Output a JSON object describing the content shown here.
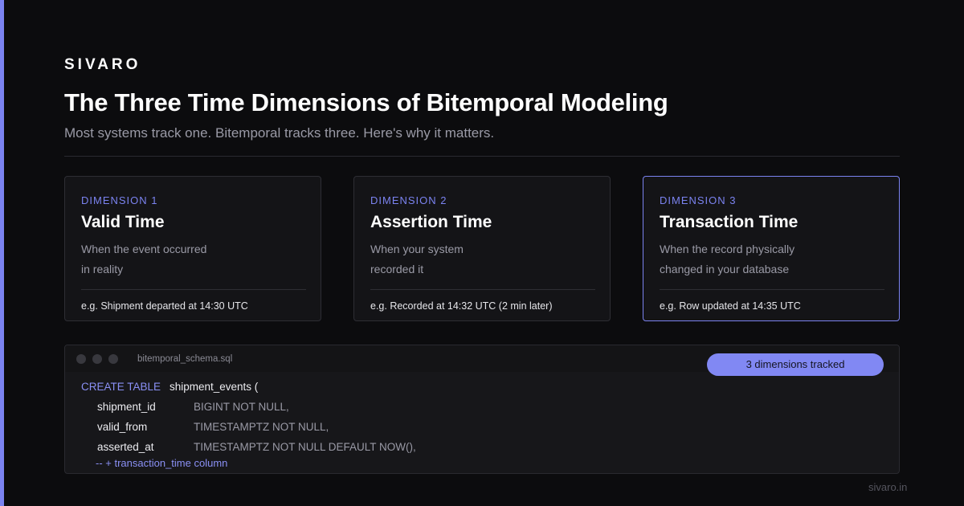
{
  "brand": "SIVARO",
  "title": "The Three Time Dimensions of Bitemporal Modeling",
  "subtitle": "Most systems track one. Bitemporal tracks three. Here's why it matters.",
  "accent_color": "#7b83f0",
  "cards": [
    {
      "kicker": "DIMENSION 1",
      "title": "Valid Time",
      "desc_lines": [
        "When the event occurred",
        "in reality"
      ],
      "example": "e.g. Shipment departed at 14:30 UTC"
    },
    {
      "kicker": "DIMENSION 2",
      "title": "Assertion Time",
      "desc_lines": [
        "When your system",
        "recorded it"
      ],
      "example": "e.g. Recorded at 14:32 UTC (2 min later)"
    },
    {
      "kicker": "DIMENSION 3",
      "title": "Transaction Time",
      "desc_lines": [
        "When the record physically",
        "changed in your database"
      ],
      "example": "e.g. Row updated at 14:35 UTC"
    }
  ],
  "code": {
    "filename": "bitemporal_schema.sql",
    "badge": "3 dimensions tracked",
    "keyword": "CREATE TABLE",
    "table": "shipment_events (",
    "columns": [
      {
        "name": "shipment_id",
        "type": "BIGINT NOT NULL,"
      },
      {
        "name": "valid_from",
        "type": "TIMESTAMPTZ NOT NULL,"
      },
      {
        "name": "asserted_at",
        "type": "TIMESTAMPTZ NOT NULL DEFAULT NOW(),"
      }
    ],
    "comment": "-- + transaction_time column"
  },
  "footer": "sivaro.in"
}
